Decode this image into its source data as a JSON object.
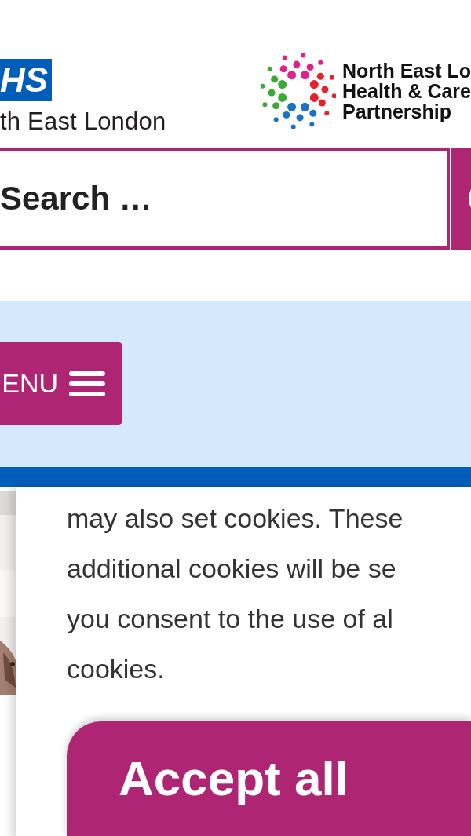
{
  "header": {
    "nhs_logo": "HS",
    "org_name": "th East London",
    "partner_lines": [
      "North East Lo",
      "Health & Care",
      "Partnership"
    ]
  },
  "search": {
    "placeholder": "Search …"
  },
  "menu": {
    "label": "ENU"
  },
  "cookie_banner": {
    "text_lines": [
      "may also set cookies. These",
      "additional cookies will be se",
      "you consent to the use of al",
      "cookies."
    ],
    "accept_button": "Accept all"
  }
}
